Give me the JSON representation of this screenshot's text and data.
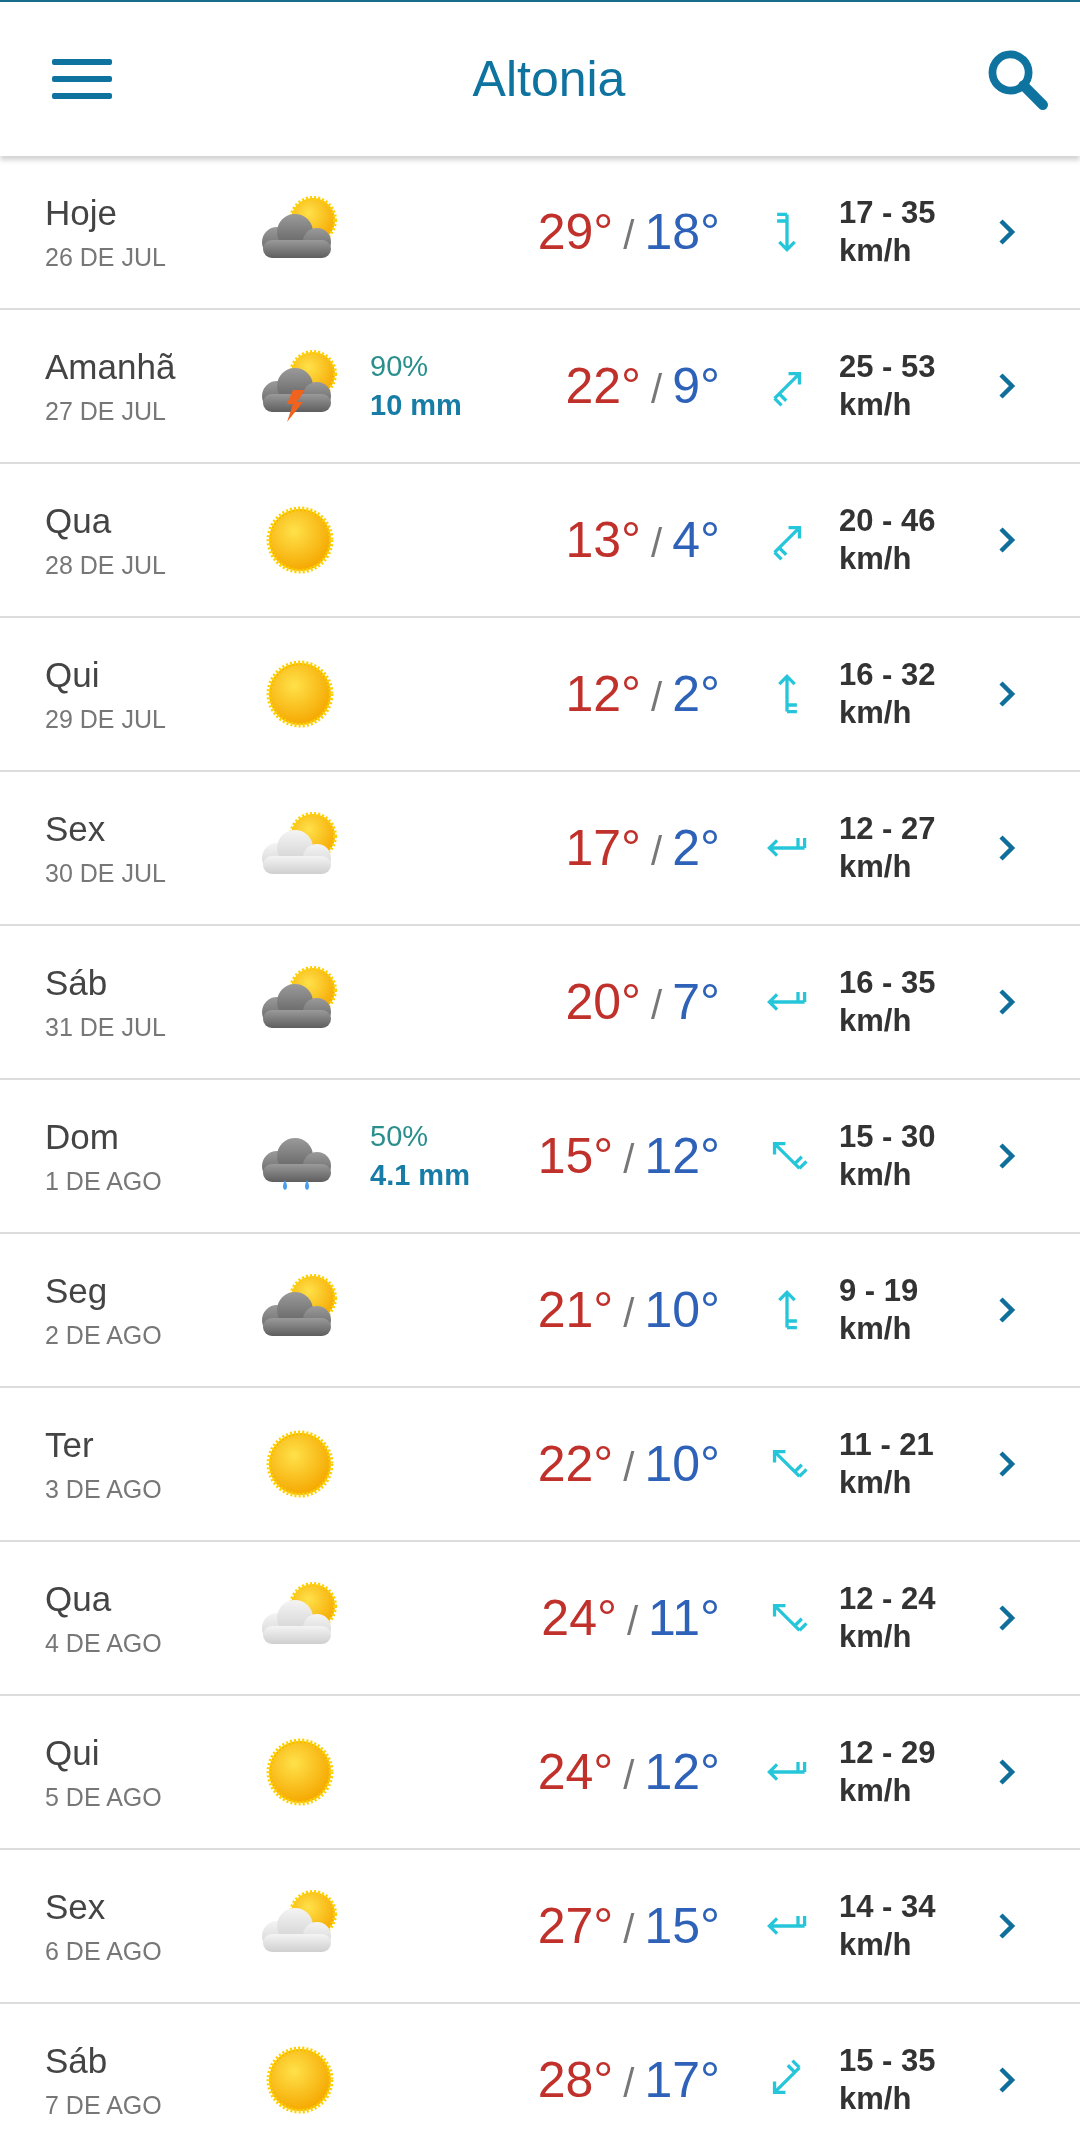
{
  "header": {
    "title": "Altonia"
  },
  "days": [
    {
      "day": "Hoje",
      "date": "26 DE JUL",
      "kind": "cloudy_sun",
      "high": "29°",
      "separator": "/",
      "low": "18°",
      "wind": {
        "kind": "to_s",
        "speed": "17 - 35",
        "unit": "km/h"
      }
    },
    {
      "day": "Amanhã",
      "date": "27 DE JUL",
      "kind": "storm",
      "chance": "90%",
      "amount": "10 mm",
      "high": "22°",
      "separator": "/",
      "low": "9°",
      "wind": {
        "kind": "to_ne",
        "speed": "25 - 53",
        "unit": "km/h"
      }
    },
    {
      "day": "Qua",
      "date": "28 DE JUL",
      "kind": "sun",
      "high": "13°",
      "separator": "/",
      "low": "4°",
      "wind": {
        "kind": "to_ne",
        "speed": "20 - 46",
        "unit": "km/h"
      }
    },
    {
      "day": "Qui",
      "date": "29 DE JUL",
      "kind": "sun",
      "high": "12°",
      "separator": "/",
      "low": "2°",
      "wind": {
        "kind": "to_n",
        "speed": "16 - 32",
        "unit": "km/h"
      }
    },
    {
      "day": "Sex",
      "date": "30 DE JUL",
      "kind": "light_cloud_sun",
      "high": "17°",
      "separator": "/",
      "low": "2°",
      "wind": {
        "kind": "to_w",
        "speed": "12 - 27",
        "unit": "km/h"
      }
    },
    {
      "day": "Sáb",
      "date": "31 DE JUL",
      "kind": "cloudy_sun",
      "high": "20°",
      "separator": "/",
      "low": "7°",
      "wind": {
        "kind": "to_w",
        "speed": "16 - 35",
        "unit": "km/h"
      }
    },
    {
      "day": "Dom",
      "date": "1 DE AGO",
      "kind": "rain",
      "chance": "50%",
      "amount": "4.1 mm",
      "high": "15°",
      "separator": "/",
      "low": "12°",
      "wind": {
        "kind": "to_nw",
        "speed": "15 - 30",
        "unit": "km/h"
      }
    },
    {
      "day": "Seg",
      "date": "2 DE AGO",
      "kind": "cloudy_sun",
      "high": "21°",
      "separator": "/",
      "low": "10°",
      "wind": {
        "kind": "to_n",
        "speed": "9 - 19",
        "unit": "km/h"
      }
    },
    {
      "day": "Ter",
      "date": "3 DE AGO",
      "kind": "sun",
      "high": "22°",
      "separator": "/",
      "low": "10°",
      "wind": {
        "kind": "to_nw",
        "speed": "11 - 21",
        "unit": "km/h"
      }
    },
    {
      "day": "Qua",
      "date": "4 DE AGO",
      "kind": "light_cloud_sun",
      "high": "24°",
      "separator": "/",
      "low": "11°",
      "wind": {
        "kind": "to_nw",
        "speed": "12 - 24",
        "unit": "km/h"
      }
    },
    {
      "day": "Qui",
      "date": "5 DE AGO",
      "kind": "sun",
      "high": "24°",
      "separator": "/",
      "low": "12°",
      "wind": {
        "kind": "to_w",
        "speed": "12 - 29",
        "unit": "km/h"
      }
    },
    {
      "day": "Sex",
      "date": "6 DE AGO",
      "kind": "light_cloud_sun",
      "high": "27°",
      "separator": "/",
      "low": "15°",
      "wind": {
        "kind": "to_w",
        "speed": "14 - 34",
        "unit": "km/h"
      }
    },
    {
      "day": "Sáb",
      "date": "7 DE AGO",
      "kind": "sun",
      "high": "28°",
      "separator": "/",
      "low": "17°",
      "wind": {
        "kind": "to_sw",
        "speed": "15 - 35",
        "unit": "km/h"
      }
    }
  ]
}
